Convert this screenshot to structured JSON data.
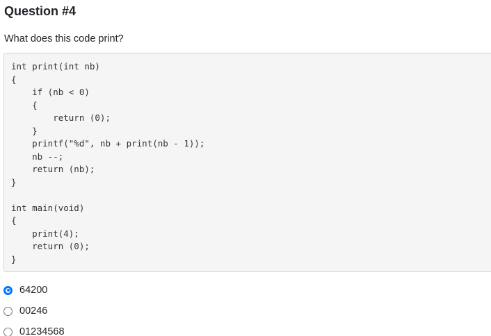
{
  "question": {
    "title": "Question #4",
    "prompt": "What does this code print?"
  },
  "code": {
    "language": "c",
    "lines": [
      "int print(int nb)",
      "{",
      "    if (nb < 0)",
      "    {",
      "        return (0);",
      "    }",
      "    printf(\"%d\", nb + print(nb - 1));",
      "    nb --;",
      "    return (nb);",
      "}",
      "",
      "int main(void)",
      "{",
      "    print(4);",
      "    return (0);",
      "}"
    ]
  },
  "options": [
    {
      "label": "64200",
      "selected": true
    },
    {
      "label": "00246",
      "selected": false
    },
    {
      "label": "01234568",
      "selected": false
    }
  ],
  "colors": {
    "accent": "#0075ff",
    "code_background": "#f5f5f5",
    "code_border": "#d5d5d5"
  }
}
